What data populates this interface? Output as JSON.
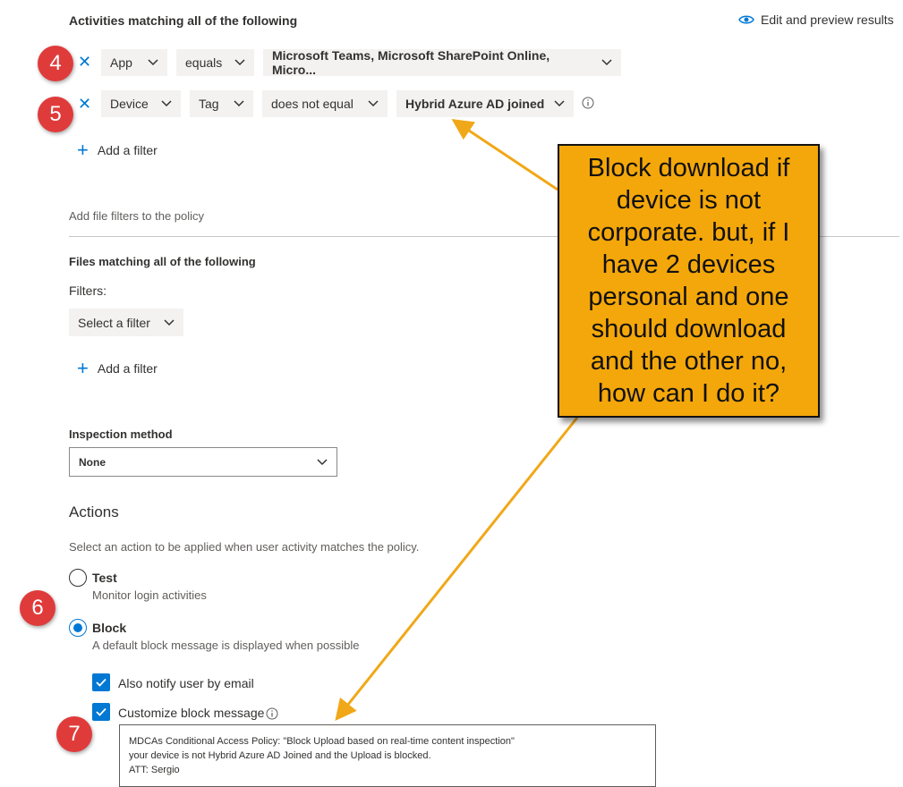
{
  "activities": {
    "title": "Activities matching all of the following",
    "edit_preview": "Edit and preview results",
    "filters": [
      {
        "field": "App",
        "operator": "equals",
        "value": "Microsoft Teams, Microsoft SharePoint Online, Micro..."
      },
      {
        "field": "Device",
        "subfield": "Tag",
        "operator": "does not equal",
        "value": "Hybrid Azure AD joined"
      }
    ],
    "add_filter": "Add a filter"
  },
  "file_filters": {
    "hint": "Add file filters to the policy",
    "title": "Files matching all of the following",
    "filters_label": "Filters:",
    "select_filter": "Select a filter",
    "add_filter": "Add a filter"
  },
  "inspection": {
    "title": "Inspection method",
    "value": "None"
  },
  "actions": {
    "title": "Actions",
    "description": "Select an action to be applied when user activity matches the policy.",
    "options": [
      {
        "label": "Test",
        "description": "Monitor login activities",
        "selected": false
      },
      {
        "label": "Block",
        "description": "A default block message is displayed when possible",
        "selected": true
      }
    ],
    "notify_email": "Also notify user by email",
    "customize_message": "Customize block message",
    "message_lines": [
      "MDCAs Conditional Access Policy: \"Block Upload based on real-time content inspection\"",
      "your device is not Hybrid Azure AD Joined and the Upload is blocked.",
      "ATT: Sergio"
    ]
  },
  "annotations": {
    "badges": [
      "4",
      "5",
      "6",
      "7"
    ],
    "callout_text": "Block download if device is not corporate. but, if I have 2 devices personal and one should download and the other no, how can I do it?",
    "callout_color": "#f4a70a",
    "badge_color": "#e03b3b"
  },
  "colors": {
    "accent": "#0078d4",
    "dropdown_bg": "#f3f2f1"
  }
}
